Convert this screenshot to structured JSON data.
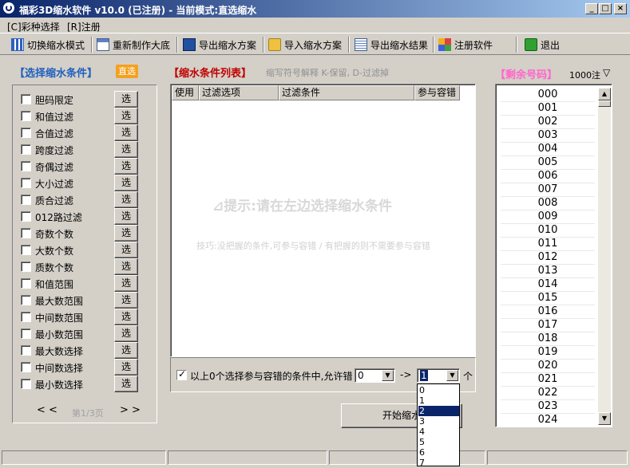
{
  "window": {
    "title": "福彩3D缩水软件 v10.0 (已注册) - 当前模式:直选缩水",
    "min_label": "_",
    "max_label": "□",
    "close_label": "×"
  },
  "menu": {
    "items": [
      {
        "label": "[C]彩种选择"
      },
      {
        "label": "[R]注册"
      }
    ]
  },
  "toolbar": {
    "items": [
      {
        "label": "切换缩水模式",
        "icon": "grid-icon"
      },
      {
        "label": "重新制作大底",
        "icon": "table-icon"
      },
      {
        "label": "导出缩水方案",
        "icon": "save-icon"
      },
      {
        "label": "导入缩水方案",
        "icon": "folder-icon"
      },
      {
        "label": "导出缩水结果",
        "icon": "document-icon"
      },
      {
        "label": "注册软件",
        "icon": "apps-icon"
      },
      {
        "label": "退出",
        "icon": "exit-icon"
      }
    ]
  },
  "left": {
    "title": "【选择缩水条件】",
    "badge": "直选",
    "select_label": "选",
    "conditions": [
      {
        "label": "胆码限定",
        "checked": false
      },
      {
        "label": "和值过滤",
        "checked": false
      },
      {
        "label": "合值过滤",
        "checked": false
      },
      {
        "label": "跨度过滤",
        "checked": false
      },
      {
        "label": "奇偶过滤",
        "checked": false
      },
      {
        "label": "大小过滤",
        "checked": false
      },
      {
        "label": "质合过滤",
        "checked": false
      },
      {
        "label": "012路过滤",
        "checked": false
      },
      {
        "label": "奇数个数",
        "checked": false
      },
      {
        "label": "大数个数",
        "checked": false
      },
      {
        "label": "质数个数",
        "checked": false
      },
      {
        "label": "和值范围",
        "checked": false
      },
      {
        "label": "最大数范围",
        "checked": false
      },
      {
        "label": "中间数范围",
        "checked": false
      },
      {
        "label": "最小数范围",
        "checked": false
      },
      {
        "label": "最大数选择",
        "checked": false
      },
      {
        "label": "中间数选择",
        "checked": false
      },
      {
        "label": "最小数选择",
        "checked": false
      }
    ],
    "prev_label": "< <",
    "page_label": "第1/3页",
    "next_label": "> >"
  },
  "middle": {
    "title": "【缩水条件列表】",
    "hint": "缩写符号解释 K-保留, D-过滤掉",
    "columns": [
      "使用",
      "过滤选项",
      "过滤条件",
      "参与容错"
    ],
    "empty_tip": "⊿提示:请在左边选择缩水条件",
    "tip2": "技巧:没把握的条件,可参与容错 / 有把握的则不需要参与容错",
    "tolerance_checked": true,
    "tolerance_text": "以上0个选择参与容错的条件中,允许错",
    "from_value": "0",
    "arrow_label": "->",
    "to_value": "1",
    "unit_label": "个",
    "start_label": "开始缩水",
    "dropdown_options": [
      "0",
      "1",
      "2",
      "3",
      "4",
      "5",
      "6",
      "7"
    ],
    "dropdown_selected": "2"
  },
  "right": {
    "title": "【剩余号码】",
    "count_label": "1000注",
    "count_arrow": "▽",
    "numbers": [
      "000",
      "001",
      "002",
      "003",
      "004",
      "005",
      "006",
      "007",
      "008",
      "009",
      "010",
      "011",
      "012",
      "013",
      "014",
      "015",
      "016",
      "017",
      "018",
      "019",
      "020",
      "021",
      "022",
      "023",
      "024"
    ]
  }
}
